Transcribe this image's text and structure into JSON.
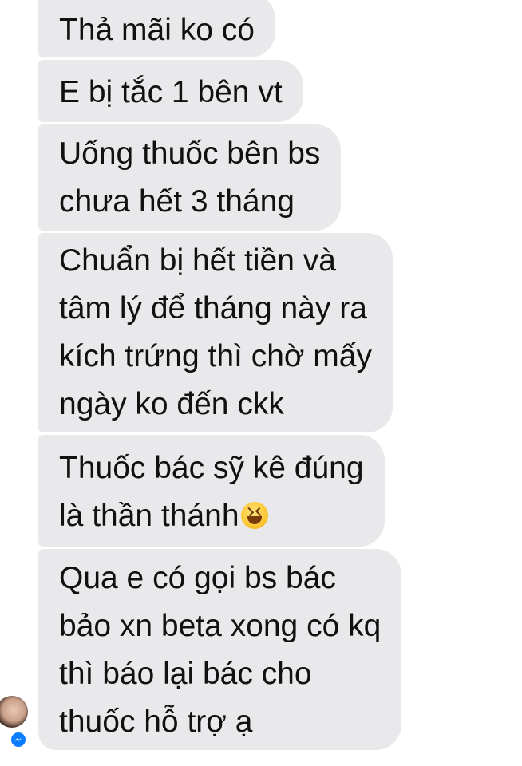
{
  "conversation": {
    "messages": [
      {
        "lines": [
          "Thả mãi ko có"
        ]
      },
      {
        "lines": [
          "E bị tắc 1 bên vt"
        ]
      },
      {
        "lines": [
          "Uống thuốc bên bs",
          "chưa hết 3 tháng"
        ]
      },
      {
        "lines": [
          "Chuẩn bị hết tiền và",
          "tâm lý để tháng này ra",
          "kích trứng thì chờ mấy",
          "ngày ko đến ckk"
        ]
      },
      {
        "lines": [
          "Thuốc bác sỹ kê đúng",
          "là thần thánh"
        ],
        "emoji": "grinning-squinting-face"
      },
      {
        "lines": [
          "Qua e có gọi bs bác",
          "bảo xn beta xong có kq",
          "thì báo lại bác cho",
          "thuốc hỗ trợ ạ"
        ]
      }
    ]
  },
  "sender": {
    "avatar_icon": "user-avatar",
    "badge_icon": "messenger-icon"
  },
  "colors": {
    "bubble_bg": "#e9e9eb",
    "text": "#111111",
    "messenger_blue": "#0a7cff"
  }
}
